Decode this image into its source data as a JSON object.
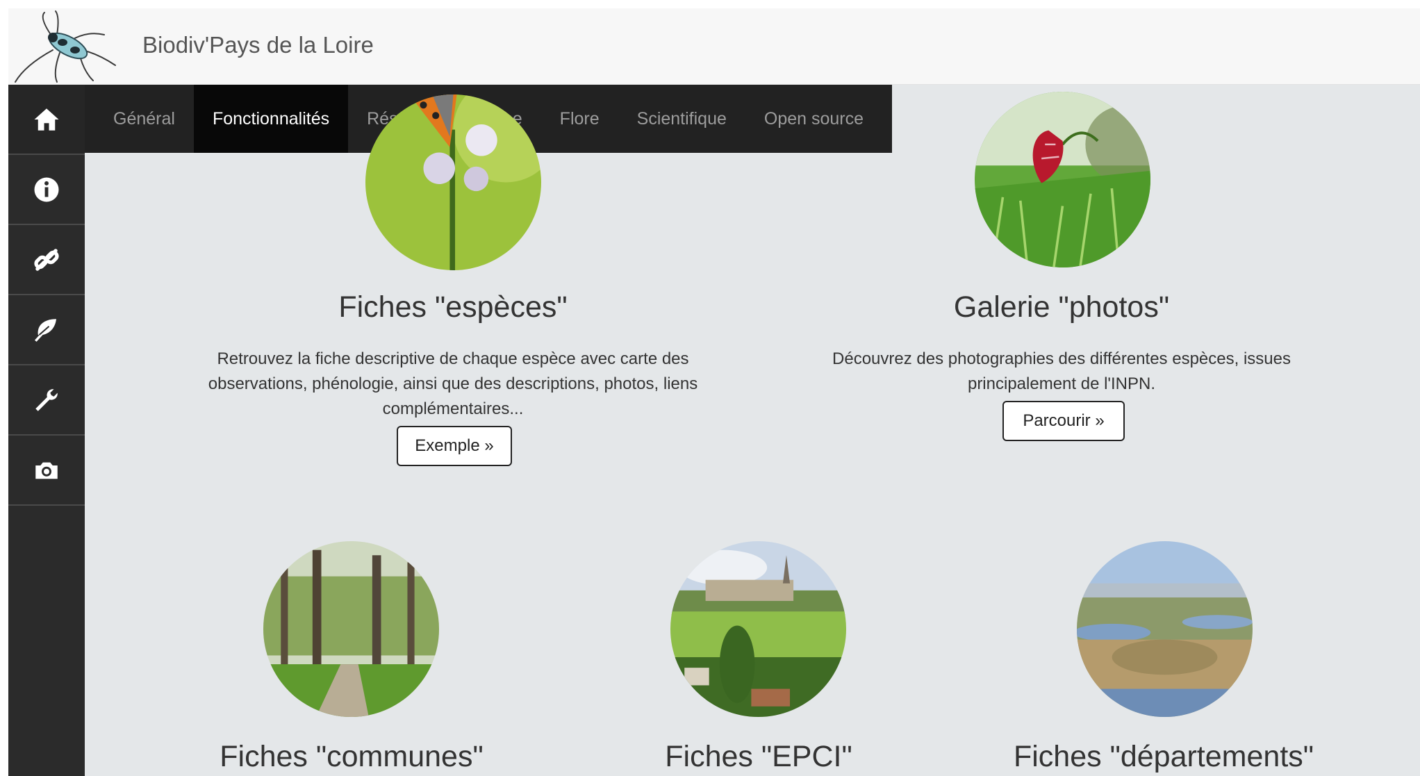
{
  "site": {
    "title": "Biodiv'Pays de la Loire",
    "logo_icon": "beetle-icon"
  },
  "sidebar": {
    "items": [
      {
        "icon": "home-icon"
      },
      {
        "icon": "info-icon"
      },
      {
        "icon": "link-icon"
      },
      {
        "icon": "leaf-icon"
      },
      {
        "icon": "wrench-icon"
      },
      {
        "icon": "camera-icon"
      }
    ]
  },
  "nav": {
    "tabs": [
      {
        "label": "Général"
      },
      {
        "label": "Fonctionnalités",
        "active": true
      },
      {
        "label": "Réseaux"
      },
      {
        "label": "Faune"
      },
      {
        "label": "Flore"
      },
      {
        "label": "Scientifique"
      },
      {
        "label": "Open source"
      }
    ]
  },
  "features": {
    "especes": {
      "title": "Fiches \"espèces\"",
      "description": "Retrouvez la fiche descriptive de chaque espèce avec carte des observations, phénologie, ainsi que des descriptions, photos, liens complémentaires...",
      "button": "Exemple »"
    },
    "photos": {
      "title": "Galerie \"photos\"",
      "description": "Découvrez des photographies des différentes espèces, issues principalement de l'INPN.",
      "button": "Parcourir »"
    },
    "communes": {
      "title": "Fiches \"communes\""
    },
    "epci": {
      "title": "Fiches \"EPCI\""
    },
    "departements": {
      "title": "Fiches \"départements\""
    }
  },
  "colors": {
    "page_background": "#e4e7e9",
    "sidebar_background": "#2b2b2b",
    "navbar_background": "#222222",
    "active_tab_background": "#080808"
  }
}
